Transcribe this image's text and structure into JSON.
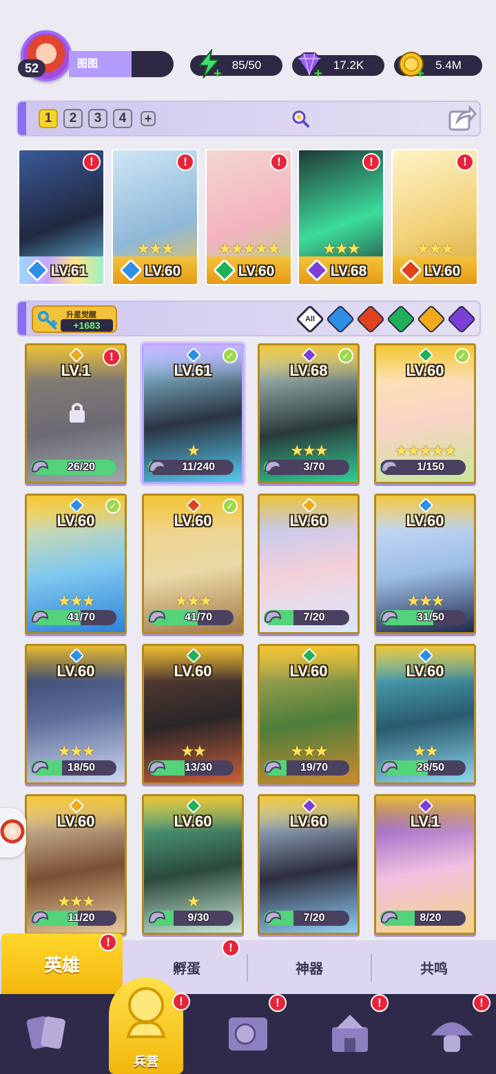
{
  "player": {
    "level": "52",
    "name": "图图"
  },
  "resources": {
    "energy": "85/50",
    "gems": "17.2K",
    "gold": "5.4M"
  },
  "team_tabs": [
    "1",
    "2",
    "3",
    "4",
    "+"
  ],
  "element_colors": {
    "water": "#2e8fe8",
    "fire": "#e0421d",
    "nature": "#1fb15a",
    "light": "#f0a91a",
    "dark": "#7b3fd6",
    "rainbow": "#b58cff"
  },
  "team_cards": [
    {
      "level": "LV.61",
      "element": "water",
      "stars": "",
      "alert": "!",
      "bg": "linear-gradient(160deg,#3b5a9a,#20283f 55%,#6dd0f6)",
      "bar": "rainbow"
    },
    {
      "level": "LV.60",
      "element": "water",
      "stars": "★★★",
      "alert": "!",
      "bg": "linear-gradient(160deg,#cfe6f6,#8fb8d8 60%,#f3c34a)",
      "bar": "gold"
    },
    {
      "level": "LV.60",
      "element": "nature",
      "stars": "★★★★★",
      "alert": "!",
      "bg": "linear-gradient(160deg,#f3d7cf,#f4b3c0 55%,#a8d87a)",
      "bar": "gold"
    },
    {
      "level": "LV.68",
      "element": "dark",
      "stars": "★★★",
      "alert": "!",
      "bg": "linear-gradient(160deg,#1f3a37,#3ddc9b 55%,#233)",
      "bar": "gold"
    },
    {
      "level": "LV.60",
      "element": "fire",
      "stars": "★★★",
      "alert": "!",
      "bg": "linear-gradient(160deg,#fff3c8,#f2d27a 55%,#d7a83c)",
      "bar": "gold"
    }
  ],
  "filter": {
    "awaken_label": "升星觉醒",
    "awaken_value": "+1683",
    "all_label": "All",
    "elements": [
      "water",
      "fire",
      "nature",
      "light",
      "dark"
    ]
  },
  "heroes": [
    {
      "level": "LV.1",
      "element": "light",
      "stars": "",
      "progress": "26/20",
      "fill": 1.0,
      "alert": true,
      "check": false,
      "locked": true,
      "bg": "linear-gradient(170deg,#8e8674,#6e6a74 60%,#9fa8b0)"
    },
    {
      "level": "LV.61",
      "element": "water",
      "stars": "★",
      "progress": "11/240",
      "fill": 0.05,
      "alert": false,
      "check": true,
      "locked": false,
      "selected": true,
      "bg": "linear-gradient(170deg,#9fe6ff,#2b3442 55%,#55c8ef)"
    },
    {
      "level": "LV.68",
      "element": "dark",
      "stars": "★★★",
      "progress": "3/70",
      "fill": 0.04,
      "alert": false,
      "check": true,
      "locked": false,
      "bg": "linear-gradient(170deg,#cfe6e2,#2a3a3a 60%,#2fcf95)"
    },
    {
      "level": "LV.60",
      "element": "nature",
      "stars": "★★★★★",
      "progress": "1/150",
      "fill": 0.01,
      "alert": false,
      "check": true,
      "locked": false,
      "bg": "linear-gradient(170deg,#ffe9a8,#f9d4c6 55%,#c9e69a)"
    },
    {
      "level": "LV.60",
      "element": "water",
      "stars": "★★★",
      "progress": "41/70",
      "fill": 0.58,
      "alert": false,
      "check": true,
      "locked": false,
      "bg": "linear-gradient(170deg,#ffe58a,#7fc8ef 55%,#2d83d9)"
    },
    {
      "level": "LV.60",
      "element": "fire",
      "stars": "★★★",
      "progress": "41/70",
      "fill": 0.58,
      "alert": false,
      "check": true,
      "locked": false,
      "bg": "linear-gradient(170deg,#f3d07c,#e9d9a6 55%,#a47a4a)"
    },
    {
      "level": "LV.60",
      "element": "light",
      "stars": "",
      "progress": "7/20",
      "fill": 0.35,
      "alert": false,
      "check": false,
      "locked": false,
      "bg": "linear-gradient(170deg,#a7c6ff,#f4d0d8 55%,#d8e9ff)"
    },
    {
      "level": "LV.60",
      "element": "water",
      "stars": "★★★",
      "progress": "31/50",
      "fill": 0.62,
      "alert": false,
      "check": false,
      "locked": false,
      "bg": "linear-gradient(170deg,#dbe7ff,#9dbde6 55%,#1f2a4a)"
    },
    {
      "level": "LV.60",
      "element": "water",
      "stars": "★★★",
      "progress": "18/50",
      "fill": 0.36,
      "alert": false,
      "check": false,
      "locked": false,
      "bg": "linear-gradient(170deg,#2c3658,#5d6d9a 50%,#cfd8f2)"
    },
    {
      "level": "LV.60",
      "element": "nature",
      "stars": "★★",
      "progress": "13/30",
      "fill": 0.43,
      "alert": false,
      "check": false,
      "locked": false,
      "bg": "linear-gradient(170deg,#6a4438,#2a2628 55%,#c75d3a)"
    },
    {
      "level": "LV.60",
      "element": "nature",
      "stars": "★★★",
      "progress": "19/70",
      "fill": 0.27,
      "alert": false,
      "check": false,
      "locked": false,
      "bg": "linear-gradient(170deg,#c8b25a,#4d7e3a 55%,#c98a32)"
    },
    {
      "level": "LV.60",
      "element": "water",
      "stars": "★★",
      "progress": "28/50",
      "fill": 0.56,
      "alert": false,
      "check": false,
      "locked": false,
      "bg": "linear-gradient(170deg,#59c7d8,#2a5a6e 55%,#8dd6ef)"
    },
    {
      "level": "LV.60",
      "element": "light",
      "stars": "★★★",
      "progress": "11/20",
      "fill": 0.55,
      "alert": false,
      "check": false,
      "locked": false,
      "bg": "linear-gradient(170deg,#f0e2c6,#7a5034 55%,#e6c89a)"
    },
    {
      "level": "LV.60",
      "element": "nature",
      "stars": "★",
      "progress": "9/30",
      "fill": 0.3,
      "alert": false,
      "check": false,
      "locked": false,
      "bg": "linear-gradient(170deg,#5ec39a,#2b4a3c 55%,#c9e8d8)"
    },
    {
      "level": "LV.60",
      "element": "dark",
      "stars": "",
      "progress": "7/20",
      "fill": 0.35,
      "alert": false,
      "check": false,
      "locked": false,
      "bg": "linear-gradient(170deg,#c9e6ff,#2d2d3f 55%,#8fcff5)"
    },
    {
      "level": "LV.1",
      "element": "dark",
      "stars": "",
      "progress": "8/20",
      "fill": 0.4,
      "alert": false,
      "check": false,
      "locked": false,
      "bg": "linear-gradient(170deg,#6e3db8,#f2c0e0 55%,#f3d48a)"
    }
  ],
  "subtabs": [
    {
      "label": "英雄",
      "active": true,
      "alert": true
    },
    {
      "label": "孵蛋",
      "active": false,
      "alert": true
    },
    {
      "label": "神器",
      "active": false,
      "alert": false
    },
    {
      "label": "共鸣",
      "active": false,
      "alert": false
    }
  ],
  "nav": {
    "active_label": "兵营",
    "items": [
      "cards-icon",
      "barracks-icon",
      "map-icon",
      "castle-icon",
      "mushroom-icon"
    ]
  }
}
